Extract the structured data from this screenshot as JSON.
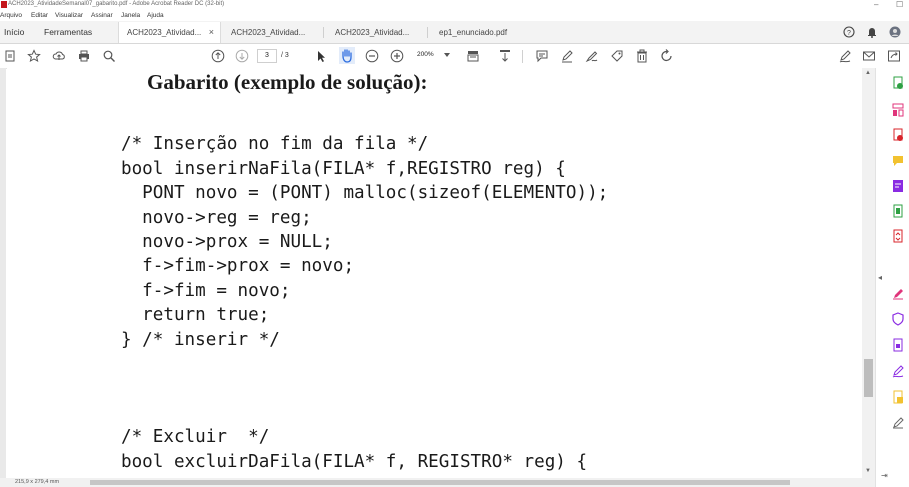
{
  "window": {
    "title": "ACH2023_AtividadeSemanal07_gabarito.pdf - Adobe Acrobat Reader DC (32-bit)",
    "minimize_glyph": "–",
    "maximize_glyph": "☐"
  },
  "menu": {
    "items": [
      "Arquivo",
      "Editar",
      "Visualizar",
      "Assinar",
      "Janela",
      "Ajuda"
    ]
  },
  "tabs": {
    "home": "Início",
    "tools": "Ferramentas",
    "documents": [
      "ACH2023_Atividad...",
      "ACH2023_Atividad...",
      "ACH2023_Atividad...",
      "ep1_enunciado.pdf"
    ],
    "close_glyph": "×"
  },
  "toolbar": {
    "current_page": "3",
    "total_pages": "/ 3",
    "zoom": "200%"
  },
  "document": {
    "heading": "Gabarito (exemplo de solução):",
    "code": [
      "/* Inserção no fim da fila */",
      "bool inserirNaFila(FILA* f,REGISTRO reg) {",
      "  PONT novo = (PONT) malloc(sizeof(ELEMENTO));",
      "  novo->reg = reg;",
      "  novo->prox = NULL;",
      "  f->fim->prox = novo;",
      "  f->fim = novo;",
      "  return true;",
      "} /* inserir */",
      "/* Excluir  */",
      "bool excluirDaFila(FILA* f, REGISTRO* reg) {"
    ]
  },
  "status": {
    "page_size": "215,9 x 279,4 mm"
  },
  "colors": {
    "red": "#d8232a",
    "green": "#2ea043",
    "purple": "#8a2be2",
    "yellow": "#f2c230",
    "pink": "#e0357b",
    "blue": "#2f6fe0"
  }
}
